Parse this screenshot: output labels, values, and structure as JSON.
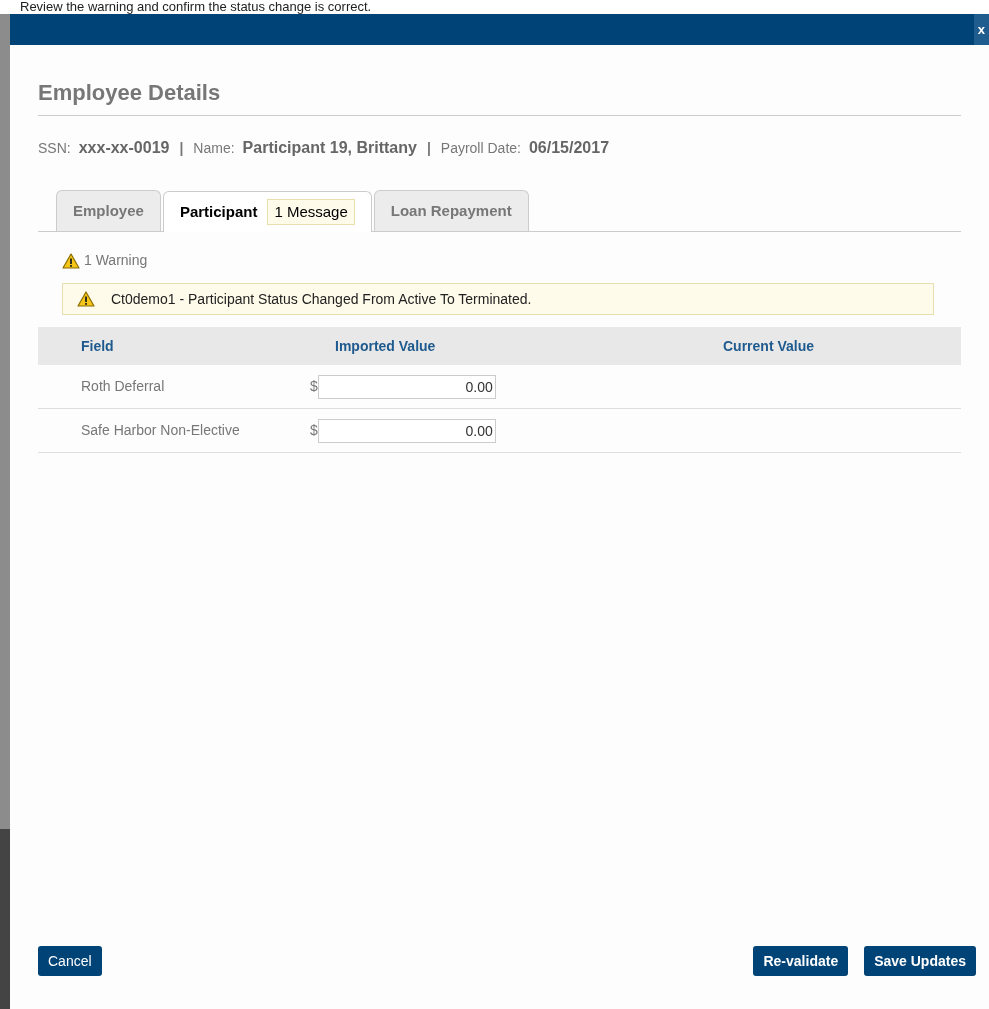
{
  "instruction": "Review the warning and confirm the status change is correct.",
  "dialog": {
    "close_label": "x",
    "title": "Employee Details",
    "info": [
      {
        "label": "SSN:",
        "value": "xxx-xx-0019"
      },
      {
        "label": "Name:",
        "value": "Participant 19, Brittany"
      },
      {
        "label": "Payroll Date:",
        "value": "06/15/2017"
      }
    ],
    "separator": "|",
    "tabs": [
      {
        "label": "Employee",
        "selected": false
      },
      {
        "label": "Participant",
        "selected": true,
        "badge": "1 Message"
      },
      {
        "label": "Loan Repayment",
        "selected": false
      }
    ],
    "warning_count": "1 Warning",
    "warnings": [
      "Ct0demo1 - Participant Status Changed From Active To Terminated."
    ],
    "table": {
      "columns": [
        "Field",
        "Imported Value",
        "Current Value"
      ],
      "rows": [
        {
          "field": "Roth Deferral",
          "currency": "$",
          "imported_value": "0.00"
        },
        {
          "field": "Safe Harbor Non-Elective",
          "currency": "$",
          "imported_value": "0.00"
        }
      ]
    },
    "buttons_left": [
      "Cancel"
    ],
    "buttons_right": [
      "Re-validate",
      "Save Updates"
    ]
  }
}
